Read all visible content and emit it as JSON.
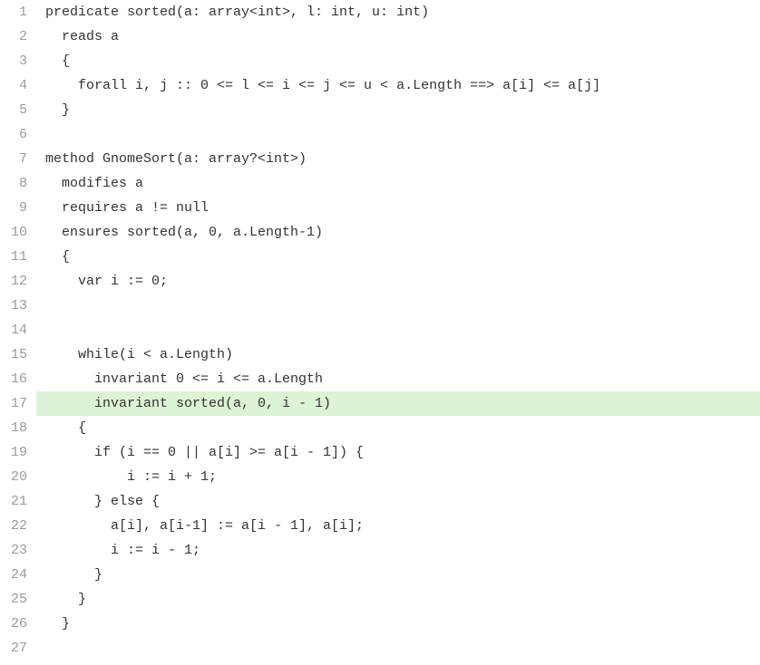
{
  "code": {
    "lines": [
      {
        "num": "1",
        "text": "predicate sorted(a: array<int>, l: int, u: int)",
        "highlight": false
      },
      {
        "num": "2",
        "text": "  reads a",
        "highlight": false
      },
      {
        "num": "3",
        "text": "  {",
        "highlight": false
      },
      {
        "num": "4",
        "text": "    forall i, j :: 0 <= l <= i <= j <= u < a.Length ==> a[i] <= a[j]",
        "highlight": false
      },
      {
        "num": "5",
        "text": "  }",
        "highlight": false
      },
      {
        "num": "6",
        "text": "",
        "highlight": false
      },
      {
        "num": "7",
        "text": "method GnomeSort(a: array?<int>)",
        "highlight": false
      },
      {
        "num": "8",
        "text": "  modifies a",
        "highlight": false
      },
      {
        "num": "9",
        "text": "  requires a != null",
        "highlight": false
      },
      {
        "num": "10",
        "text": "  ensures sorted(a, 0, a.Length-1)",
        "highlight": false
      },
      {
        "num": "11",
        "text": "  {",
        "highlight": false
      },
      {
        "num": "12",
        "text": "    var i := 0;",
        "highlight": false
      },
      {
        "num": "13",
        "text": "",
        "highlight": false
      },
      {
        "num": "14",
        "text": "",
        "highlight": false
      },
      {
        "num": "15",
        "text": "    while(i < a.Length)",
        "highlight": false
      },
      {
        "num": "16",
        "text": "      invariant 0 <= i <= a.Length",
        "highlight": false
      },
      {
        "num": "17",
        "text": "      invariant sorted(a, 0, i - 1)",
        "highlight": true
      },
      {
        "num": "18",
        "text": "    {",
        "highlight": false
      },
      {
        "num": "19",
        "text": "      if (i == 0 || a[i] >= a[i - 1]) {",
        "highlight": false
      },
      {
        "num": "20",
        "text": "          i := i + 1;",
        "highlight": false
      },
      {
        "num": "21",
        "text": "      } else {",
        "highlight": false
      },
      {
        "num": "22",
        "text": "        a[i], a[i-1] := a[i - 1], a[i];",
        "highlight": false
      },
      {
        "num": "23",
        "text": "        i := i - 1;",
        "highlight": false
      },
      {
        "num": "24",
        "text": "      }",
        "highlight": false
      },
      {
        "num": "25",
        "text": "    }",
        "highlight": false
      },
      {
        "num": "26",
        "text": "  }",
        "highlight": false
      },
      {
        "num": "27",
        "text": "",
        "highlight": false
      }
    ]
  }
}
